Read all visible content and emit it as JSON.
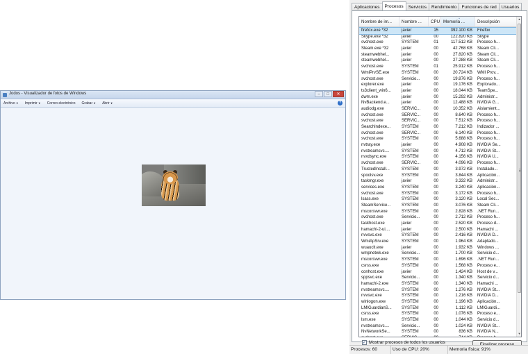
{
  "viewer": {
    "title": "Jodos - Visualizador de fotos de Windows",
    "window_controls": {
      "minimize": "–",
      "maximize": "□",
      "close": "✕"
    },
    "menu": [
      {
        "label": "Archivo",
        "icon": "chevron-down-icon"
      },
      {
        "label": "Imprimir",
        "icon": "chevron-down-icon"
      },
      {
        "label": "Correo electrónico",
        "icon": ""
      },
      {
        "label": "Grabar",
        "icon": "chevron-down-icon"
      },
      {
        "label": "Abrir",
        "icon": "chevron-down-icon"
      }
    ],
    "help_label": "?",
    "photo_subject": "tiger-cub-on-rock"
  },
  "taskmgr": {
    "tabs": [
      "Aplicaciones",
      "Procesos",
      "Servicios",
      "Rendimiento",
      "Funciones de red",
      "Usuarios"
    ],
    "active_tab": "Procesos",
    "columns": [
      "Nombre de im...",
      "Nombre ...",
      "CPU",
      "Memoria ...",
      "Descripción"
    ],
    "sorted_column": "Memoria ...",
    "rows": [
      [
        "firefox.exe *32",
        "javier",
        "15",
        "392.100 KB",
        "Firefox"
      ],
      [
        "Skype.exe *32",
        "javier",
        "00",
        "122.820 KB",
        "Skype"
      ],
      [
        "svchost.exe",
        "SYSTEM",
        "01",
        "117.512 KB",
        "Proceso h..."
      ],
      [
        "Steam.exe *32",
        "javier",
        "00",
        "42.768 KB",
        "Steam Cli..."
      ],
      [
        "steamwebhel...",
        "javier",
        "00",
        "27.820 KB",
        "Steam Cli..."
      ],
      [
        "steamwebhel...",
        "javier",
        "00",
        "27.288 KB",
        "Steam Cli..."
      ],
      [
        "svchost.exe",
        "SYSTEM",
        "01",
        "25.912 KB",
        "Proceso h..."
      ],
      [
        "WmiPrvSE.exe",
        "SYSTEM",
        "00",
        "20.724 KB",
        "WMI Prov..."
      ],
      [
        "svchost.exe",
        "Servicio...",
        "00",
        "19.876 KB",
        "Proceso h..."
      ],
      [
        "explorer.exe",
        "javier",
        "00",
        "19.176 KB",
        "Explorado..."
      ],
      [
        "ts3client_win6...",
        "javier",
        "00",
        "18.044 KB",
        "TeamSpe..."
      ],
      [
        "dwm.exe",
        "javier",
        "00",
        "15.292 KB",
        "Administr..."
      ],
      [
        "NvBackend.e...",
        "javier",
        "00",
        "12.488 KB",
        "NVIDIA G..."
      ],
      [
        "audiodg.exe",
        "SERVIC...",
        "00",
        "10.352 KB",
        "Aislamient..."
      ],
      [
        "svchost.exe",
        "SERVIC...",
        "00",
        "8.640 KB",
        "Proceso h..."
      ],
      [
        "svchost.exe",
        "SERVIC...",
        "00",
        "7.512 KB",
        "Proceso h..."
      ],
      [
        "SearchIndexe...",
        "SYSTEM",
        "00",
        "7.212 KB",
        "Indizador ..."
      ],
      [
        "svchost.exe",
        "SERVIC...",
        "00",
        "6.140 KB",
        "Proceso h..."
      ],
      [
        "svchost.exe",
        "SYSTEM",
        "00",
        "5.688 KB",
        "Proceso h..."
      ],
      [
        "nvtray.exe",
        "javier",
        "00",
        "4.908 KB",
        "NVIDIA Se..."
      ],
      [
        "nvstreamsvc....",
        "SYSTEM",
        "00",
        "4.712 KB",
        "NVIDIA St..."
      ],
      [
        "nvxdsync.exe",
        "SYSTEM",
        "00",
        "4.156 KB",
        "NVIDIA U..."
      ],
      [
        "svchost.exe",
        "SERVIC...",
        "00",
        "4.096 KB",
        "Proceso h..."
      ],
      [
        "TrustedInstall...",
        "SYSTEM",
        "00",
        "3.972 KB",
        "Instalado..."
      ],
      [
        "spoolsv.exe",
        "SYSTEM",
        "00",
        "3.844 KB",
        "Aplicación..."
      ],
      [
        "taskmgr.exe",
        "javier",
        "00",
        "3.332 KB",
        "Administr..."
      ],
      [
        "services.exe",
        "SYSTEM",
        "00",
        "3.240 KB",
        "Aplicación..."
      ],
      [
        "svchost.exe",
        "SYSTEM",
        "00",
        "3.172 KB",
        "Proceso h..."
      ],
      [
        "lsass.exe",
        "SYSTEM",
        "00",
        "3.120 KB",
        "Local Sec..."
      ],
      [
        "SteamService...",
        "SYSTEM",
        "00",
        "3.076 KB",
        "Steam Cli..."
      ],
      [
        "mscorsvw.exe",
        "SYSTEM",
        "00",
        "2.828 KB",
        ".NET Run..."
      ],
      [
        "svchost.exe",
        "Servicio...",
        "00",
        "2.712 KB",
        "Proceso h..."
      ],
      [
        "taskhost.exe",
        "javier",
        "00",
        "2.520 KB",
        "Proceso d..."
      ],
      [
        "hamachi-2-ui....",
        "javier",
        "00",
        "2.500 KB",
        "Hamachi ..."
      ],
      [
        "nvvsvc.exe",
        "SYSTEM",
        "00",
        "2.416 KB",
        "NVIDIA D..."
      ],
      [
        "WmiApSrv.exe",
        "SYSTEM",
        "00",
        "1.964 KB",
        "Adaptado..."
      ],
      [
        "wuauclt.exe",
        "javier",
        "00",
        "1.932 KB",
        "Windows ..."
      ],
      [
        "wmpnetwk.exe",
        "Servicio...",
        "00",
        "1.700 KB",
        "Servicio d..."
      ],
      [
        "mscorsvw.exe",
        "SYSTEM",
        "00",
        "1.696 KB",
        ".NET Run..."
      ],
      [
        "csrss.exe",
        "SYSTEM",
        "00",
        "1.568 KB",
        "Proceso e..."
      ],
      [
        "conhost.exe",
        "javier",
        "00",
        "1.424 KB",
        "Host de v..."
      ],
      [
        "sppsvc.exe",
        "Servicio...",
        "00",
        "1.340 KB",
        "Servicio d..."
      ],
      [
        "hamachi-2.exe",
        "SYSTEM",
        "00",
        "1.340 KB",
        "Hamachi ..."
      ],
      [
        "nvstreamsvc....",
        "SYSTEM",
        "00",
        "1.276 KB",
        "NVIDIA St..."
      ],
      [
        "nvvsvc.exe",
        "SYSTEM",
        "00",
        "1.216 KB",
        "NVIDIA D..."
      ],
      [
        "winlogon.exe",
        "SYSTEM",
        "00",
        "1.196 KB",
        "Aplicación..."
      ],
      [
        "LMIGuardianS...",
        "SYSTEM",
        "00",
        "1.112 KB",
        "LMIGuardi..."
      ],
      [
        "csrss.exe",
        "SYSTEM",
        "00",
        "1.076 KB",
        "Proceso e..."
      ],
      [
        "lsm.exe",
        "SYSTEM",
        "00",
        "1.044 KB",
        "Servicio d..."
      ],
      [
        "nvstreamsvc....",
        "Servicio...",
        "00",
        "1.024 KB",
        "NVIDIA St..."
      ],
      [
        "NvNetworkSe...",
        "SYSTEM",
        "00",
        "836 KB",
        "NVIDIA N..."
      ],
      [
        "svchost.exe",
        "SERVIC...",
        "00",
        "744 KB",
        "Proceso h..."
      ]
    ],
    "show_all_label": "Mostrar procesos de todos los usuarios",
    "show_all_checked": "✓",
    "end_process_label": "Finalizar proceso",
    "status": {
      "processes": "Procesos: 60",
      "cpu": "Uso de CPU: 20%",
      "memory": "Memoria física: 91%"
    }
  }
}
